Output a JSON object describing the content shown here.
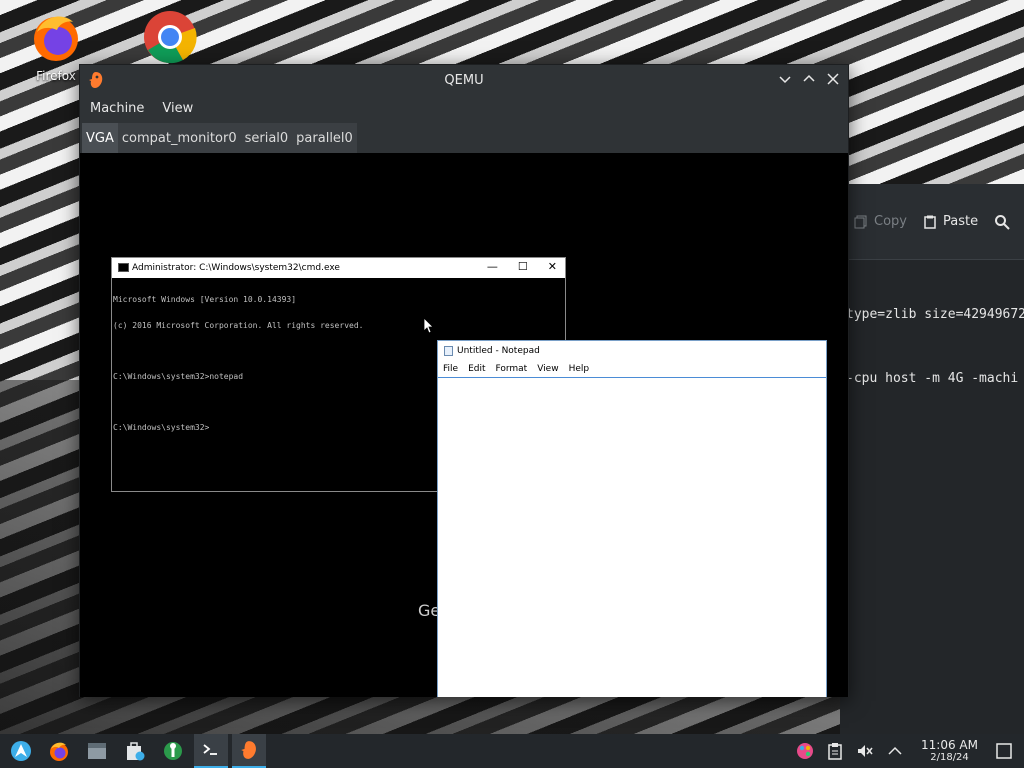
{
  "desktop": {
    "icons": [
      {
        "label": "Firefox",
        "icon": "firefox-icon"
      },
      {
        "label": "",
        "icon": "chrome-icon"
      }
    ]
  },
  "background_terminal": {
    "toolbar": {
      "copy_label": "Copy",
      "paste_label": "Paste"
    },
    "lines": [
      "type=zlib size=42949672",
      "-cpu host -m 4G -machi"
    ]
  },
  "qemu": {
    "title": "QEMU",
    "menu": [
      "Machine",
      "View"
    ],
    "tabs": [
      {
        "label": "VGA",
        "active": true
      },
      {
        "label": "compat_monitor0",
        "active": false
      },
      {
        "label": "serial0",
        "active": false
      },
      {
        "label": "parallel0",
        "active": false
      }
    ],
    "screen_text": "Ge"
  },
  "cmd": {
    "title": "Administrator: C:\\Windows\\system32\\cmd.exe",
    "lines": [
      "Microsoft Windows [Version 10.0.14393]",
      "(c) 2016 Microsoft Corporation. All rights reserved.",
      "",
      "C:\\Windows\\system32>notepad",
      "",
      "C:\\Windows\\system32>"
    ]
  },
  "notepad": {
    "title": "Untitled - Notepad",
    "menu": [
      "File",
      "Edit",
      "Format",
      "View",
      "Help"
    ]
  },
  "taskbar": {
    "apps": [
      "launcher-icon",
      "firefox-icon",
      "files-icon",
      "store-icon",
      "tools-icon",
      "terminal-icon",
      "qemu-icon"
    ],
    "clock": {
      "time": "11:06 AM",
      "date": "2/18/24"
    }
  },
  "colors": {
    "accent": "#3daee9",
    "window_bg": "#2f3336",
    "taskbar_bg": "#23272b"
  }
}
